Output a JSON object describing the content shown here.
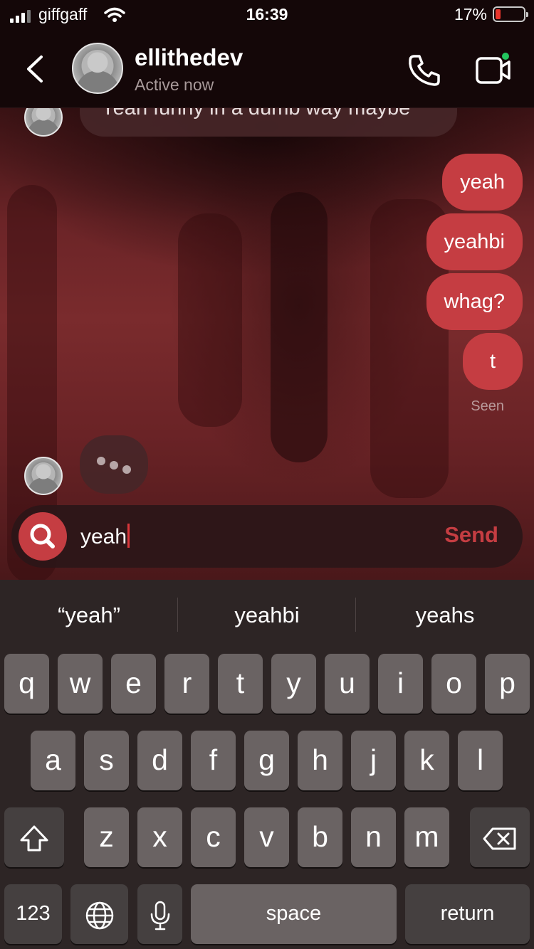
{
  "status_bar": {
    "carrier": "giffgaff",
    "time": "16:39",
    "battery_percent": "17%",
    "battery_level": 0.17
  },
  "header": {
    "contact_name": "ellithedev",
    "presence": "Active now"
  },
  "messages": {
    "incoming_partial": "Yeah funny in a dumb way maybe",
    "outgoing": [
      "yeah",
      "yeahbi",
      "whag?",
      "t"
    ],
    "seen_label": "Seen"
  },
  "composer": {
    "value": "yeah",
    "send_label": "Send"
  },
  "keyboard": {
    "suggestions": [
      "“yeah”",
      "yeahbi",
      "yeahs"
    ],
    "row1": [
      "q",
      "w",
      "e",
      "r",
      "t",
      "y",
      "u",
      "i",
      "o",
      "p"
    ],
    "row2": [
      "a",
      "s",
      "d",
      "f",
      "g",
      "h",
      "j",
      "k",
      "l"
    ],
    "row3": [
      "z",
      "x",
      "c",
      "v",
      "b",
      "n",
      "m"
    ],
    "numbers_label": "123",
    "space_label": "space",
    "return_label": "return"
  },
  "colors": {
    "accent": "#c53d42",
    "online": "#22c55e"
  }
}
